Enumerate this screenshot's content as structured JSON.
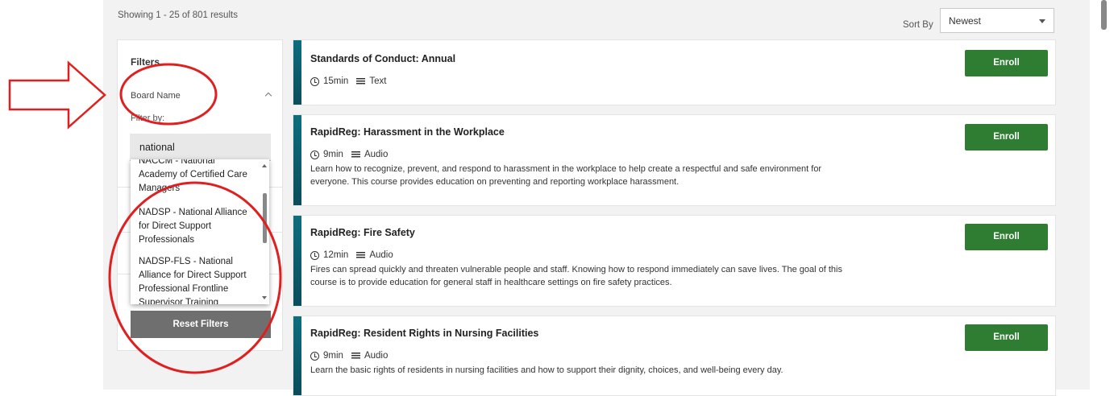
{
  "header": {
    "results_count": "Showing 1 - 25 of 801 results",
    "sort_label": "Sort By",
    "sort_value": "Newest"
  },
  "filters": {
    "title": "Filters",
    "board_name_label": "Board Name",
    "filter_by_label": "Filter by:",
    "search_value": "national",
    "reset_label": "Reset Filters",
    "options": [
      {
        "label": "NACCM - National Academy of Certified Care Managers"
      },
      {
        "label": "NADSP - National Alliance for Direct Support Professionals"
      },
      {
        "label": "NADSP-FLS - National Alliance for Direct Support Professional Frontline Supervisor Training"
      }
    ]
  },
  "courses": [
    {
      "title": "Standards of Conduct: Annual",
      "duration": "15min",
      "format": "Text",
      "description": "",
      "enroll_label": "Enroll"
    },
    {
      "title": "RapidReg: Harassment in the Workplace",
      "duration": "9min",
      "format": "Audio",
      "description": "Learn how to recognize, prevent, and respond to harassment in the workplace to help create a respectful and safe environment for everyone. This course provides education on preventing and reporting workplace harassment.",
      "enroll_label": "Enroll"
    },
    {
      "title": "RapidReg: Fire Safety",
      "duration": "12min",
      "format": "Audio",
      "description": "Fires can spread quickly and threaten vulnerable people and staff. Knowing how to respond immediately can save lives. The goal of this course is to provide education for general staff in healthcare settings on fire safety practices.",
      "enroll_label": "Enroll"
    },
    {
      "title": "RapidReg: Resident Rights in Nursing Facilities",
      "duration": "9min",
      "format": "Audio",
      "description": "Learn the basic rights of residents in nursing facilities and how to support their dignity, choices, and well-being every day.",
      "enroll_label": "Enroll"
    }
  ],
  "colors": {
    "enroll_green": "#2e7d32",
    "card_accent": "#0d6e7e",
    "annotation_red": "#e02020"
  }
}
